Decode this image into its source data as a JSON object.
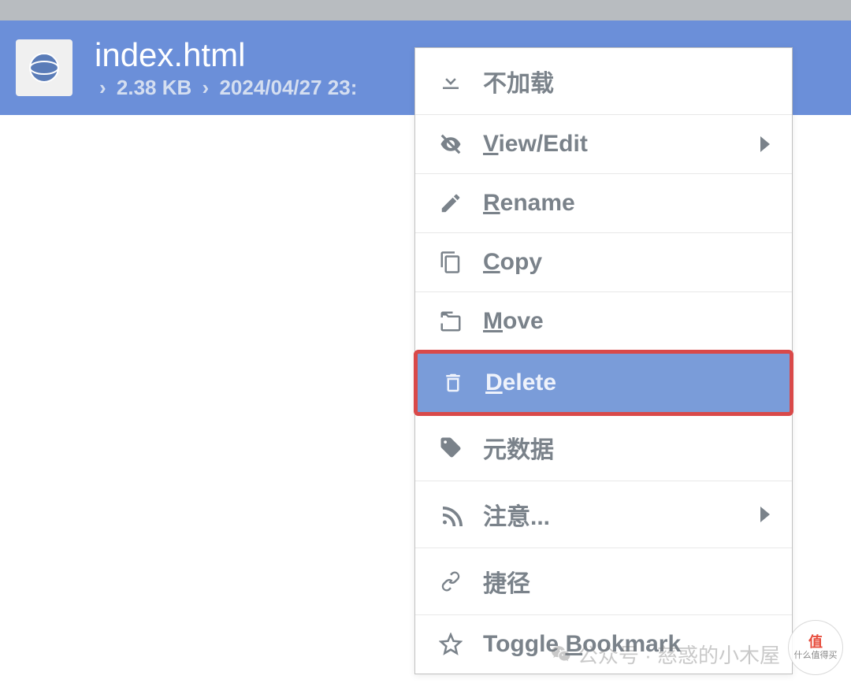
{
  "header": {
    "file_name": "index.html",
    "file_size": "2.38 KB",
    "file_date": "2024/04/27 23:"
  },
  "menu": {
    "items": [
      {
        "label": "不加载",
        "underline_char": "",
        "has_submenu": false,
        "icon": "download"
      },
      {
        "label": "View/Edit",
        "underline_char": "V",
        "has_submenu": true,
        "icon": "eye-off"
      },
      {
        "label": "Rename",
        "underline_char": "R",
        "has_submenu": false,
        "icon": "pencil"
      },
      {
        "label": "Copy",
        "underline_char": "C",
        "has_submenu": false,
        "icon": "copy"
      },
      {
        "label": "Move",
        "underline_char": "M",
        "has_submenu": false,
        "icon": "move"
      },
      {
        "label": "Delete",
        "underline_char": "D",
        "has_submenu": false,
        "icon": "trash",
        "highlighted": true
      },
      {
        "label": "元数据",
        "underline_char": "",
        "has_submenu": false,
        "icon": "tags"
      },
      {
        "label": "注意...",
        "underline_char": "",
        "has_submenu": true,
        "icon": "rss"
      },
      {
        "label": "捷径",
        "underline_char": "",
        "has_submenu": false,
        "icon": "link"
      },
      {
        "label": "Toggle Bookmark",
        "underline_char": "B",
        "has_submenu": false,
        "icon": "star"
      }
    ]
  },
  "watermark": {
    "text": "公众号 · 慈惑的小木屋",
    "badge_brand": "值",
    "badge_text": "什么值得买"
  }
}
